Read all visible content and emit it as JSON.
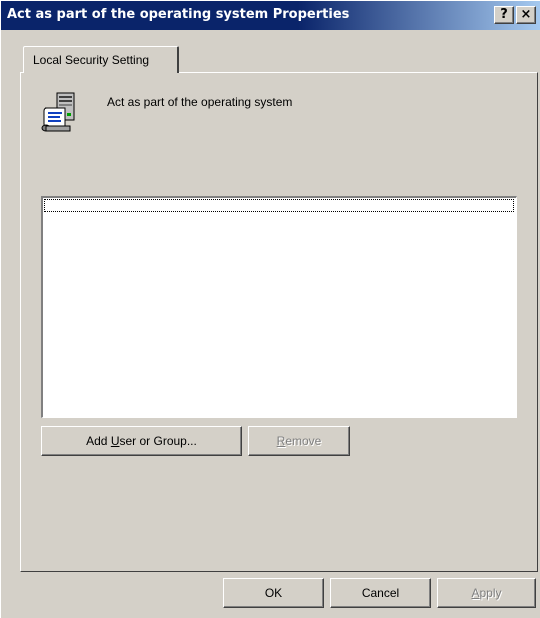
{
  "window": {
    "title": "Act as part of the operating system Properties",
    "help_label": "?",
    "close_label": "×"
  },
  "tabs": [
    {
      "label": "Local Security Setting",
      "selected": true
    }
  ],
  "policy": {
    "name": "Act as part of the operating system",
    "icon": "policy-scroll-icon"
  },
  "list": {
    "items": []
  },
  "buttons": {
    "add_pre": "Add ",
    "add_mnemonic": "U",
    "add_post": "ser or Group...",
    "remove_mnemonic": "R",
    "remove_post": "emove",
    "ok": "OK",
    "cancel": "Cancel",
    "apply_mnemonic": "A",
    "apply_post": "pply"
  },
  "colors": {
    "face": "#d4d0c8",
    "title_active": "#0a246a",
    "title_gradient_end": "#a6caf0"
  }
}
